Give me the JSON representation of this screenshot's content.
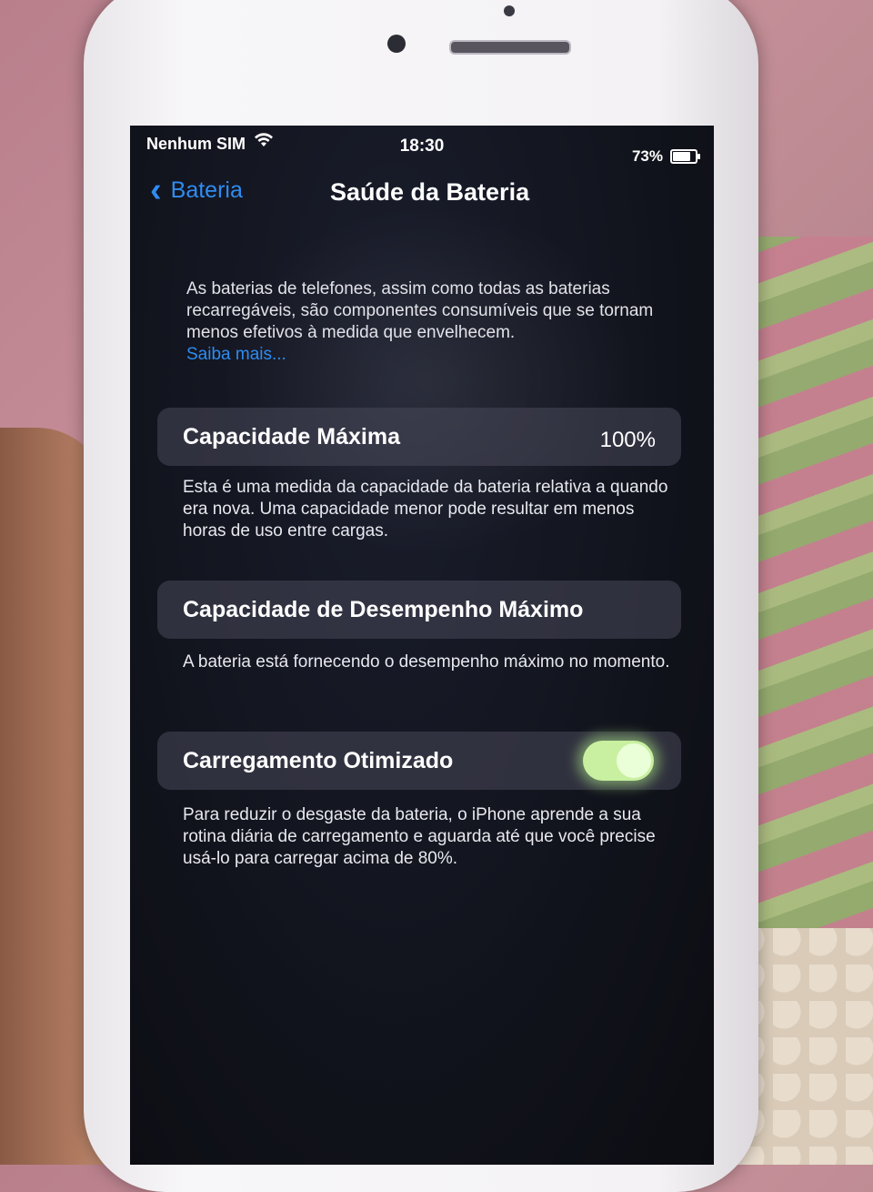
{
  "status_bar": {
    "carrier": "Nenhum SIM",
    "wifi_icon": "wifi-icon",
    "time": "18:30",
    "battery_percent": "73%",
    "battery_level": 0.73
  },
  "nav": {
    "back_label": "Bateria",
    "title": "Saúde da Bateria"
  },
  "intro": {
    "text": "As baterias de telefones, assim como todas as baterias recarregáveis, são componentes consumíveis que se tornam menos efetivos à medida que envelhecem.",
    "link": "Saiba mais..."
  },
  "max_capacity": {
    "label": "Capacidade Máxima",
    "value": "100%",
    "footer": "Esta é uma medida da capacidade da bateria relativa a quando era nova. Uma capacidade menor pode resultar em menos horas de uso entre cargas."
  },
  "peak_performance": {
    "label": "Capacidade de Desempenho Máximo",
    "footer": "A bateria está fornecendo o desempenho máximo no momento."
  },
  "optimized_charging": {
    "label": "Carregamento Otimizado",
    "enabled": true,
    "footer": "Para reduzir o desgaste da bateria, o iPhone aprende a sua rotina diária de carregamento e aguarda até que você precise usá-lo para carregar acima de 80%."
  },
  "colors": {
    "accent": "#2f8cf2",
    "toggle_on": "#c8f0a0",
    "screen_bg": "#11131c"
  }
}
